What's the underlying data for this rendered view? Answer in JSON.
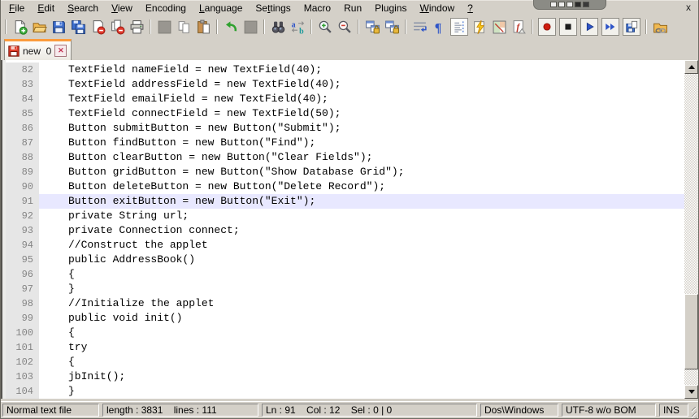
{
  "menu": {
    "items": [
      {
        "name": "file",
        "label": "File",
        "underline": 0
      },
      {
        "name": "edit",
        "label": "Edit",
        "underline": 0
      },
      {
        "name": "search",
        "label": "Search",
        "underline": 0
      },
      {
        "name": "view",
        "label": "View",
        "underline": 0
      },
      {
        "name": "encoding",
        "label": "Encoding",
        "underline": -1
      },
      {
        "name": "language",
        "label": "Language",
        "underline": 0
      },
      {
        "name": "settings",
        "label": "Settings",
        "underline": 2
      },
      {
        "name": "macro",
        "label": "Macro",
        "underline": -1
      },
      {
        "name": "run",
        "label": "Run",
        "underline": -1
      },
      {
        "name": "plugins",
        "label": "Plugins",
        "underline": -1
      },
      {
        "name": "window",
        "label": "Window",
        "underline": 0
      },
      {
        "name": "help",
        "label": "?",
        "underline": 0
      }
    ],
    "mdi_close_label": "x"
  },
  "recorder_overlay": {
    "squares": [
      "#eeeeee",
      "#eeeeee",
      "#eeeeee",
      "#2a2a2a",
      "#3a3a3a"
    ]
  },
  "toolbar": {
    "items": [
      {
        "name": "separator"
      },
      {
        "name": "new-file"
      },
      {
        "name": "open"
      },
      {
        "name": "save"
      },
      {
        "name": "save-all"
      },
      {
        "name": "close"
      },
      {
        "name": "close-all"
      },
      {
        "name": "print"
      },
      {
        "name": "separator"
      },
      {
        "name": "cut",
        "disabled": true
      },
      {
        "name": "copy",
        "disabled": true
      },
      {
        "name": "paste"
      },
      {
        "name": "separator"
      },
      {
        "name": "undo"
      },
      {
        "name": "redo",
        "disabled": true
      },
      {
        "name": "separator"
      },
      {
        "name": "find"
      },
      {
        "name": "replace"
      },
      {
        "name": "separator"
      },
      {
        "name": "zoom-in"
      },
      {
        "name": "zoom-out"
      },
      {
        "name": "separator"
      },
      {
        "name": "sync-vertical"
      },
      {
        "name": "sync-horizontal"
      },
      {
        "name": "separator"
      },
      {
        "name": "word-wrap"
      },
      {
        "name": "show-all-characters"
      },
      {
        "name": "show-indent-guide",
        "pressed": true
      },
      {
        "name": "user-dialog"
      },
      {
        "name": "doc-map"
      },
      {
        "name": "function-doc"
      },
      {
        "name": "separator"
      },
      {
        "name": "macro-record"
      },
      {
        "name": "macro-stop"
      },
      {
        "name": "macro-play"
      },
      {
        "name": "macro-run-multiple"
      },
      {
        "name": "macro-save"
      },
      {
        "name": "separator"
      },
      {
        "name": "folder-link"
      }
    ]
  },
  "tabbar": {
    "tabs": [
      {
        "label": "new  0",
        "modified": true,
        "active": true
      }
    ]
  },
  "editor": {
    "current_line": 91,
    "lines": [
      {
        "num": 82,
        "code": "TextField nameField = new TextField(40);"
      },
      {
        "num": 83,
        "code": "TextField addressField = new TextField(40);"
      },
      {
        "num": 84,
        "code": "TextField emailField = new TextField(40);"
      },
      {
        "num": 85,
        "code": "TextField connectField = new TextField(50);"
      },
      {
        "num": 86,
        "code": "Button submitButton = new Button(\"Submit\");"
      },
      {
        "num": 87,
        "code": "Button findButton = new Button(\"Find\");"
      },
      {
        "num": 88,
        "code": "Button clearButton = new Button(\"Clear Fields\");"
      },
      {
        "num": 89,
        "code": "Button gridButton = new Button(\"Show Database Grid\");"
      },
      {
        "num": 90,
        "code": "Button deleteButton = new Button(\"Delete Record\");"
      },
      {
        "num": 91,
        "code": "Button exitButton = new Button(\"Exit\");"
      },
      {
        "num": 92,
        "code": "private String url;"
      },
      {
        "num": 93,
        "code": "private Connection connect;"
      },
      {
        "num": 94,
        "code": "//Construct the applet"
      },
      {
        "num": 95,
        "code": "public AddressBook()"
      },
      {
        "num": 96,
        "code": "{"
      },
      {
        "num": 97,
        "code": "}"
      },
      {
        "num": 98,
        "code": "//Initialize the applet"
      },
      {
        "num": 99,
        "code": "public void init()"
      },
      {
        "num": 100,
        "code": "{"
      },
      {
        "num": 101,
        "code": "try"
      },
      {
        "num": 102,
        "code": "{"
      },
      {
        "num": 103,
        "code": "jbInit();"
      },
      {
        "num": 104,
        "code": "}"
      }
    ]
  },
  "statusbar": {
    "fields": [
      {
        "name": "doc-type",
        "text": "Normal text file"
      },
      {
        "name": "length-lines",
        "text": "length : 3831    lines : 111"
      },
      {
        "name": "cursor-position",
        "text": "Ln : 91    Col : 12    Sel : 0 | 0"
      },
      {
        "name": "eol-format",
        "text": "Dos\\Windows"
      },
      {
        "name": "encoding",
        "text": "UTF-8 w/o BOM"
      },
      {
        "name": "insert-mode",
        "text": "INS"
      }
    ]
  },
  "colors": {
    "chrome": "#d4d0c8",
    "tab_accent_orange": "#fb9b3c",
    "current_line_bg": "#e8e8ff",
    "gutter_bg": "#e6e6e6",
    "gutter_fg": "#848484",
    "code_fg": "#000000",
    "modified_floppy_red": "#e03c28"
  }
}
